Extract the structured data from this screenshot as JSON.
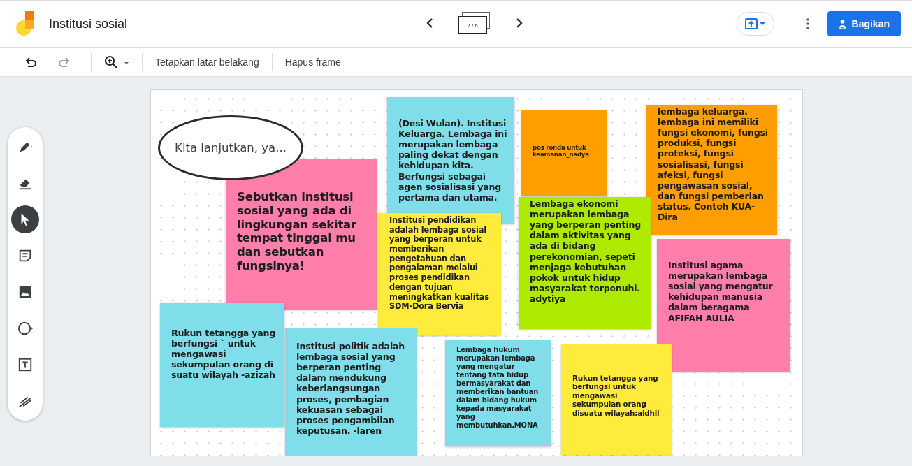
{
  "header": {
    "title": "Institusi sosial",
    "frame_indicator": "2 / 6",
    "share_button": "Bagikan"
  },
  "toolbar": {
    "undo": {
      "disabled": false
    },
    "redo": {
      "disabled": true
    },
    "actions": [
      "Tetapkan latar belakang",
      "Hapus frame"
    ]
  },
  "tools": [
    {
      "kind": "pen",
      "selected": false
    },
    {
      "kind": "eraser",
      "selected": false
    },
    {
      "kind": "select",
      "selected": true
    },
    {
      "kind": "note",
      "selected": false
    },
    {
      "kind": "image",
      "selected": false
    },
    {
      "kind": "circle",
      "selected": false
    },
    {
      "kind": "textbox",
      "selected": false
    },
    {
      "kind": "laser",
      "selected": false
    }
  ],
  "canvas": {
    "items": [
      {
        "kind": "ellipse",
        "text": "Kita lanjutkan, ya..."
      },
      {
        "kind": "sticky",
        "color": "#ff7eaa",
        "text": "Sebutkan institusi sosial yang ada di lingkungan sekitar tempat tinggal mu dan sebutkan fungsinya!"
      },
      {
        "kind": "sticky",
        "color": "#80deea",
        "text": "(Desi Wulan). Institusi Keluarga. Lembaga ini merupakan lembaga paling dekat dengan kehidupan kita. Berfungsi sebagai agen sosialisasi yang pertama dan utama."
      },
      {
        "kind": "sticky",
        "color": "#ff9e00",
        "text": "pos ronda untuk keamanan_nadya"
      },
      {
        "kind": "sticky",
        "color": "#ff9e00",
        "text": "lembaga keluarga. lembaga ini memiliki fungsi ekonomi, fungsi produksi, fungsi proteksi, fungsi sosialisasi, fungsi afeksi, fungsi pengawasan sosial, dan fungsi pemberian status. Contoh KUA-Dira"
      },
      {
        "kind": "sticky",
        "color": "#ffeb3b",
        "text": "Institusi pendidikan adalah lembaga sosial yang berperan untuk memberikan pengetahuan dan pengalaman melalui proses pendidikan dengan tujuan meningkatkan kualitas SDM-Dora Bervia"
      },
      {
        "kind": "sticky",
        "color": "#aeea00",
        "text": "Lembaga ekonomi merupakan lembaga yang berperan penting dalam aktivitas yang ada di bidang perekonomian, sepeti menjaga kebutuhan pokok untuk hidup masyarakat terpenuhi. adytiya"
      },
      {
        "kind": "sticky",
        "color": "#ff7eaa",
        "text": "Institusi agama merupakan lembaga sosial yang mengatur kehidupan manusia dalam beragama AFIFAH AULIA"
      },
      {
        "kind": "sticky",
        "color": "#80deea",
        "text": "Rukun tetangga yang berfungsi ` untuk mengawasi sekumpulan orang di suatu wilayah -azizah"
      },
      {
        "kind": "sticky",
        "color": "#80deea",
        "text": "Institusi politik adalah lembaga sosial yang berperan penting dalam mendukung keberlangsungan proses, pembagian kekuasan sebagai proses pengambilan keputusan. -laren"
      },
      {
        "kind": "sticky",
        "color": "#80deea",
        "text": "Lembaga hukum merupakan lembaga yang mengatur tentang tata hidup bermasyarakat dan memberikan bantuan dalam bidang hukum kepada masyarakat yang membutuhkan.MONA"
      },
      {
        "kind": "sticky",
        "color": "#ffeb3b",
        "text": "Rukun tetangga yang berfungsi untuk mengawasi sekumpulan orang disuatu wilayah:aidhil"
      }
    ]
  }
}
